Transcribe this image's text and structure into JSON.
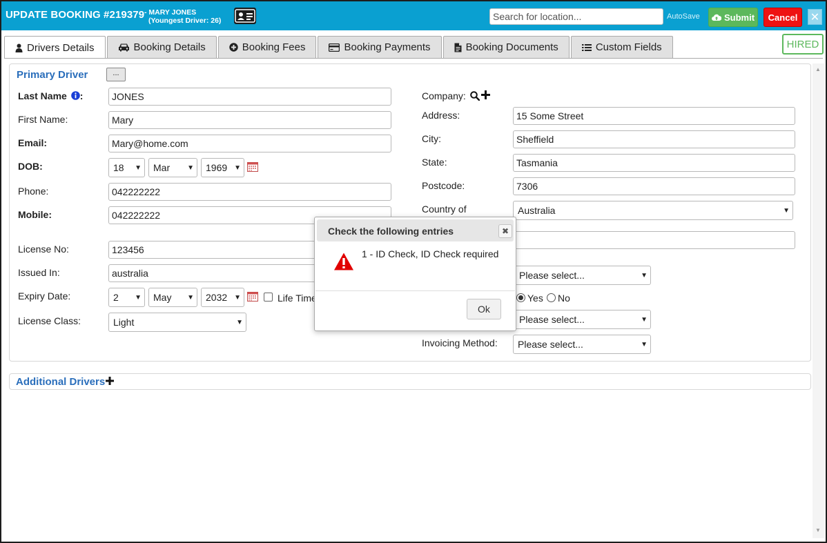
{
  "header": {
    "title": "UPDATE BOOKING #219379",
    "customer_line1": "- MARY JONES",
    "customer_line2": "(Youngest Driver: 26)",
    "search_placeholder": "Search for location...",
    "autosave_label": "AutoSave",
    "submit_label": "Submit",
    "cancel_label": "Cancel",
    "close_glyph": "✕"
  },
  "tabs": [
    {
      "label": "Drivers Details",
      "icon": "user-icon",
      "active": true
    },
    {
      "label": "Booking Details",
      "icon": "car-icon"
    },
    {
      "label": "Booking Fees",
      "icon": "plus-circle-icon"
    },
    {
      "label": "Booking Payments",
      "icon": "credit-card-icon"
    },
    {
      "label": "Booking Documents",
      "icon": "document-icon"
    },
    {
      "label": "Custom Fields",
      "icon": "list-icon"
    }
  ],
  "status_badge": "HIRED",
  "primary_driver": {
    "title": "Primary Driver",
    "more_label": "...",
    "labels": {
      "last_name": "Last Name",
      "first_name": "First Name:",
      "email": "Email:",
      "dob": "DOB:",
      "phone": "Phone:",
      "mobile": "Mobile:",
      "license_no": "License No:",
      "issued_in": "Issued In:",
      "expiry_date": "Expiry Date:",
      "license_class": "License Class:",
      "company": "Company:",
      "address": "Address:",
      "city": "City:",
      "state": "State:",
      "postcode": "Postcode:",
      "country": "Country of",
      "invoicing_method": "Invoicing Method:",
      "life_time": "Life Time",
      "yes": "Yes",
      "no": "No"
    },
    "values": {
      "last_name": "JONES",
      "first_name": "Mary",
      "email": "Mary@home.com",
      "dob_day": "18",
      "dob_month": "Mar",
      "dob_year": "1969",
      "phone": "042222222",
      "mobile": "042222222",
      "license_no": "123456",
      "issued_in": "australia",
      "expiry_day": "2",
      "expiry_month": "May",
      "expiry_year": "2032",
      "license_class": "Light",
      "address": "15 Some Street",
      "city": "Sheffield",
      "state": "Tasmania",
      "postcode": "7306",
      "country": "Australia",
      "select1": "Please select...",
      "select2": "Please select...",
      "invoicing_method": "Please select..."
    },
    "yes_selected": true
  },
  "additional_drivers": {
    "title": "Additional Drivers"
  },
  "modal": {
    "title": "Check the following entries",
    "message": "1 - ID Check, ID Check required",
    "ok_label": "Ok",
    "close_glyph": "✖"
  },
  "colors": {
    "header_bg": "#0aa0d1",
    "submit_bg": "#5cb85c",
    "cancel_bg": "#ee1212",
    "section_title": "#2a6ebb",
    "info_icon": "#1a3fd6",
    "warning_icon": "#e10000"
  }
}
